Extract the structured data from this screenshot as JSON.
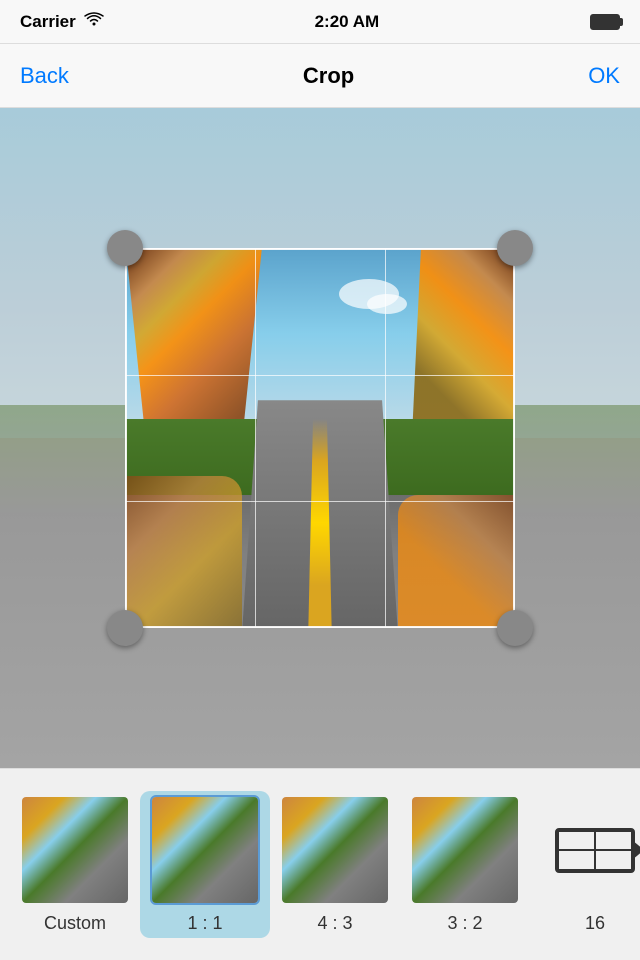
{
  "statusBar": {
    "carrier": "Carrier",
    "wifi": "wifi",
    "time": "2:20 AM",
    "battery": "full"
  },
  "navBar": {
    "backLabel": "Back",
    "title": "Crop",
    "okLabel": "OK"
  },
  "cropArea": {
    "handleSize": 36
  },
  "ratioItems": [
    {
      "id": "custom",
      "label": "Custom",
      "selected": false,
      "type": "photo"
    },
    {
      "id": "1-1",
      "label": "1 : 1",
      "selected": true,
      "type": "photo"
    },
    {
      "id": "4-3",
      "label": "4 : 3",
      "selected": false,
      "type": "photo"
    },
    {
      "id": "3-2",
      "label": "3 : 2",
      "selected": false,
      "type": "photo"
    },
    {
      "id": "16-9",
      "label": "16",
      "selected": false,
      "type": "icon"
    }
  ]
}
